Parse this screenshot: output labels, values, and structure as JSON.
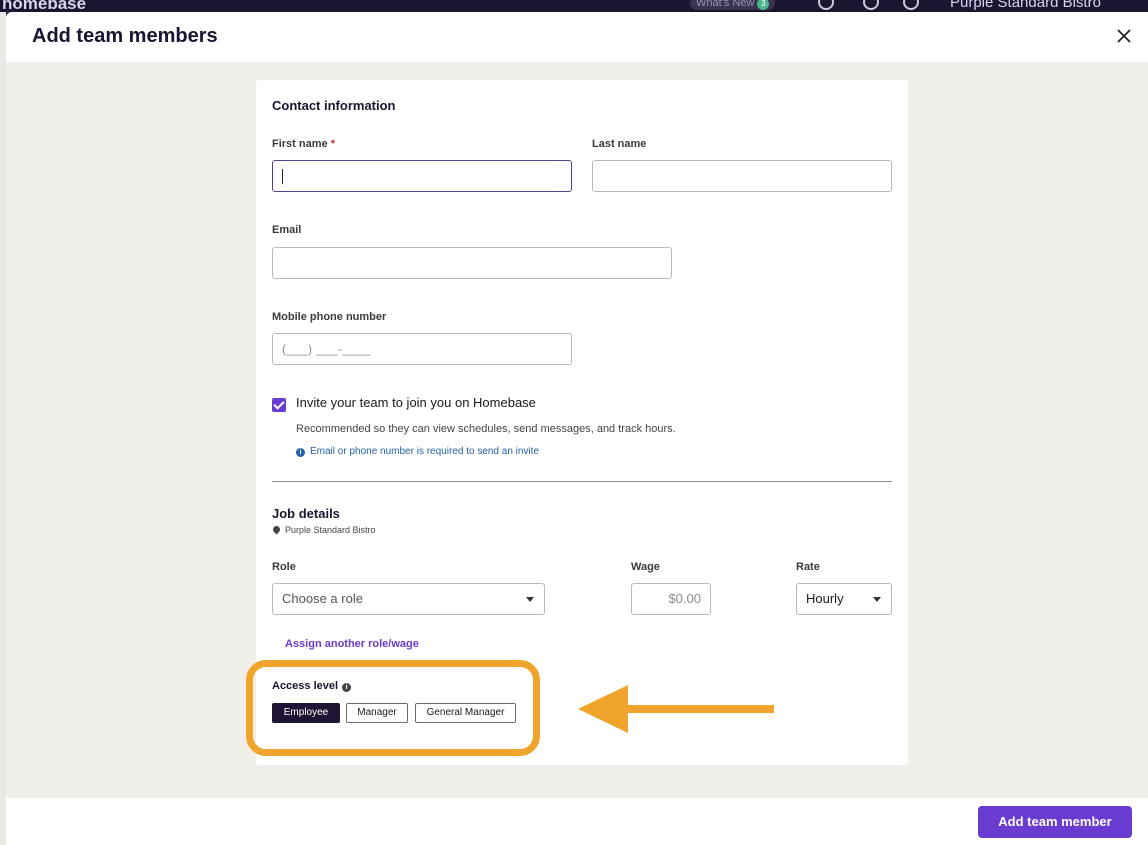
{
  "background": {
    "brand": "homebase",
    "whats_new": "What's New",
    "whats_new_count": "3",
    "location_name": "Purple Standard Bistro",
    "icons": [
      "clock-icon",
      "chat-icon",
      "bell-icon"
    ]
  },
  "modal": {
    "title": "Add team members",
    "contact": {
      "section_title": "Contact information",
      "first_name_label": "First name",
      "required_mark": "*",
      "last_name_label": "Last name",
      "email_label": "Email",
      "phone_label": "Mobile phone number",
      "phone_placeholder": "(___) ___-____",
      "first_name_value": "",
      "last_name_value": "",
      "email_value": ""
    },
    "invite": {
      "checked": true,
      "label": "Invite your team to join you on Homebase",
      "subtext": "Recommended so they can view schedules, send messages, and track hours.",
      "info_note": "Email or phone number is required to send an invite",
      "info_icon": "i"
    },
    "job": {
      "section_title": "Job details",
      "location": "Purple Standard Bistro",
      "role_label": "Role",
      "role_placeholder": "Choose a role",
      "wage_label": "Wage",
      "wage_placeholder": "$0.00",
      "rate_label": "Rate",
      "rate_value": "Hourly",
      "assign_link": "Assign another role/wage"
    },
    "access": {
      "label": "Access level",
      "info_icon": "i",
      "options": [
        "Employee",
        "Manager",
        "General Manager"
      ],
      "selected": "Employee"
    },
    "footer": {
      "submit_label": "Add team member"
    }
  },
  "colors": {
    "accent": "#6a3bd1",
    "highlight": "#f0a42c",
    "selected_pill": "#1f1433",
    "info": "#2462a8"
  }
}
